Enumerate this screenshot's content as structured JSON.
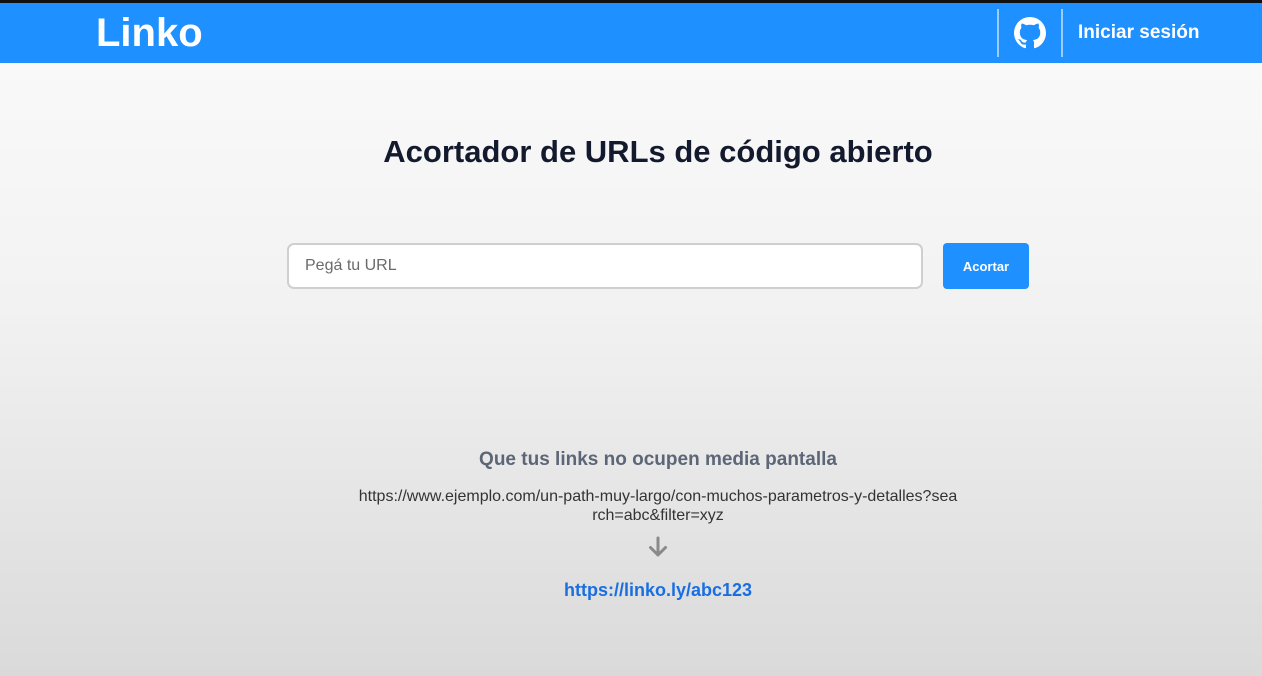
{
  "header": {
    "logo": "Linko",
    "github_icon": "github-icon",
    "login_label": "Iniciar sesión"
  },
  "main": {
    "title": "Acortador de URLs de código abierto",
    "url_input": {
      "placeholder": "Pegá tu URL",
      "value": ""
    },
    "shorten_button": "Acortar"
  },
  "example": {
    "tagline": "Que tus links no ocupen media pantalla",
    "long_url": "https://www.ejemplo.com/un-path-muy-largo/con-muchos-parametros-y-detalles?search=abc&filter=xyz",
    "arrow_icon": "arrow-down-icon",
    "short_url": "https://linko.ly/abc123"
  },
  "colors": {
    "accent": "#1e90ff",
    "title": "#141a2e",
    "tagline": "#5d6677",
    "link": "#1a6fe0"
  }
}
